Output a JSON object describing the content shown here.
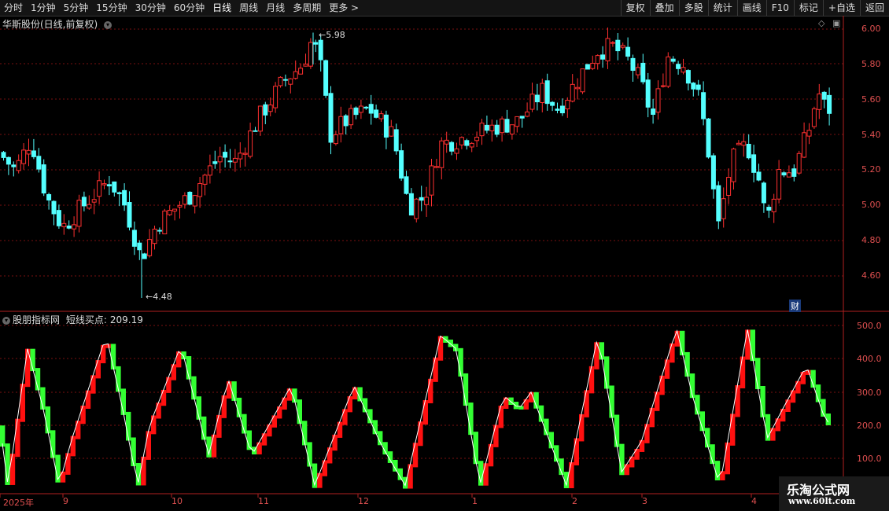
{
  "toolbar": {
    "left": [
      "分时",
      "1分钟",
      "5分钟",
      "15分钟",
      "30分钟",
      "60分钟",
      "日线",
      "周线",
      "月线",
      "多周期",
      "更多 >"
    ],
    "active": "日线",
    "right": [
      "复权",
      "叠加",
      "多股",
      "统计",
      "画线",
      "F10",
      "标记",
      "+自选",
      "返回"
    ]
  },
  "main": {
    "title": "华斯股份(日线,前复权)",
    "high_label": "5.98",
    "low_label": "4.48",
    "cai_badge": "财",
    "y_ticks": [
      "6.00",
      "5.80",
      "5.60",
      "5.40",
      "5.20",
      "5.00",
      "4.80",
      "4.60"
    ]
  },
  "indicator": {
    "title": "股朋指标网",
    "series_label": "短线买点:",
    "value": "209.19",
    "y_ticks": [
      "500.0",
      "400.0",
      "300.0",
      "200.0",
      "100.0"
    ]
  },
  "x_axis": [
    "2025年",
    "9",
    "10",
    "11",
    "12",
    "1",
    "2",
    "3",
    "4"
  ],
  "watermark": {
    "line1": "乐淘公式网",
    "line2": "www.60lt.com"
  },
  "colors": {
    "up": "#ff3030",
    "down": "#54ffff",
    "ind_up": "#ff1010",
    "ind_down": "#33ff33",
    "grid": "#7a1010",
    "border": "#b02020"
  }
}
